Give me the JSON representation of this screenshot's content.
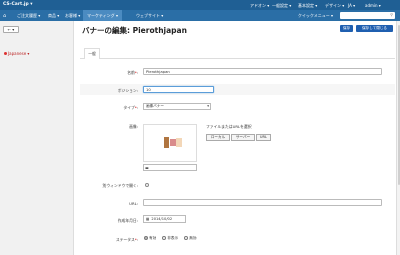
{
  "topbar": {
    "brand": "CS-Cart.jp ▾",
    "menu": [
      "アドオン ▾",
      "一般設定 ▾",
      "基本設定 ▾",
      "デザイン ▾",
      "JA ▾",
      "admin ▾"
    ]
  },
  "nav": {
    "items": [
      "ご注文履歴 ▾",
      "商品 ▾",
      "お客様 ▾",
      "マーケティング ▾",
      "ウェブサイト ▾"
    ],
    "quick_menu": "クイックメニュー ▾",
    "search_placeholder": ""
  },
  "left": {
    "back": "← ▾",
    "language": "Japanese ▾"
  },
  "page": {
    "title": "バナーの編集: Pierothjapan",
    "save": "保存",
    "save_close": "保存して閉じる"
  },
  "tabs": [
    "一般"
  ],
  "form": {
    "name_label": "名前",
    "name_required": "*",
    "name_value": "Pierothjapan",
    "position_label": "ポジション",
    "position_value": "10",
    "type_label": "タイプ",
    "type_required": "*",
    "type_value": "画像バナー",
    "image_label": "画像",
    "file_select": "ファイルまたはURLを選択",
    "file_buttons": [
      "ローカル",
      "サーバー",
      "URL"
    ],
    "new_window_label": "別ウィンドウで開く",
    "url_label": "URL",
    "date_label": "作成年月日",
    "date_value": "2014/10/02",
    "status_label": "ステータス",
    "status_required": "*",
    "status_options": [
      "有効",
      "非表示",
      "無効"
    ],
    "status_selected": "有効"
  }
}
